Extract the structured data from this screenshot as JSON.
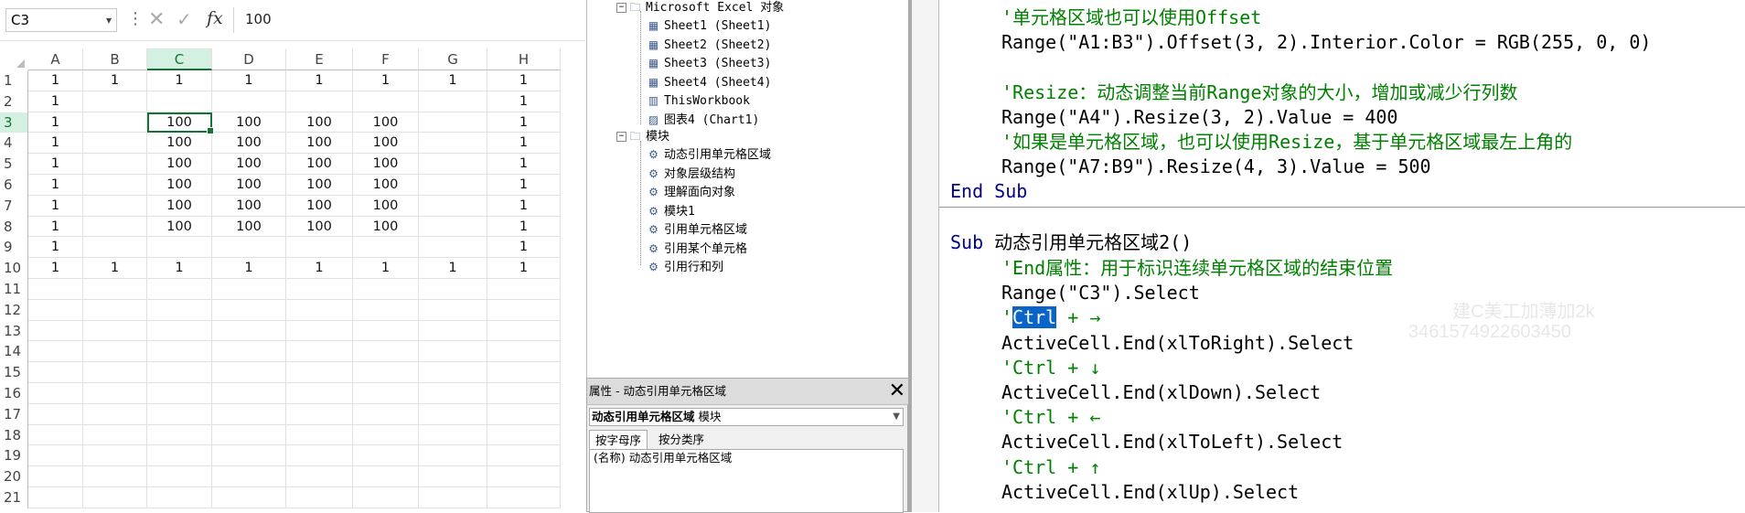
{
  "excel": {
    "name_box": "C3",
    "formula_value": "100",
    "fx_label": "fx",
    "columns": [
      "A",
      "B",
      "C",
      "D",
      "E",
      "F",
      "G",
      "H"
    ],
    "selected_column": "C",
    "selected_row": "3",
    "row_labels": [
      "1",
      "2",
      "3",
      "4",
      "5",
      "6",
      "7",
      "8",
      "9",
      "10",
      "11",
      "12",
      "13",
      "14",
      "15",
      "16",
      "17",
      "18",
      "19",
      "20",
      "21"
    ],
    "rows": [
      [
        "1",
        "1",
        "1",
        "1",
        "1",
        "1",
        "1",
        "1"
      ],
      [
        "1",
        "",
        "",
        "",
        "",
        "",
        "",
        "1"
      ],
      [
        "1",
        "",
        "100",
        "100",
        "100",
        "100",
        "",
        "1"
      ],
      [
        "1",
        "",
        "100",
        "100",
        "100",
        "100",
        "",
        "1"
      ],
      [
        "1",
        "",
        "100",
        "100",
        "100",
        "100",
        "",
        "1"
      ],
      [
        "1",
        "",
        "100",
        "100",
        "100",
        "100",
        "",
        "1"
      ],
      [
        "1",
        "",
        "100",
        "100",
        "100",
        "100",
        "",
        "1"
      ],
      [
        "1",
        "",
        "100",
        "100",
        "100",
        "100",
        "",
        "1"
      ],
      [
        "1",
        "",
        "",
        "",
        "",
        "",
        "",
        "1"
      ],
      [
        "1",
        "1",
        "1",
        "1",
        "1",
        "1",
        "1",
        "1"
      ],
      [
        "",
        "",
        "",
        "",
        "",
        "",
        "",
        ""
      ],
      [
        "",
        "",
        "",
        "",
        "",
        "",
        "",
        ""
      ],
      [
        "",
        "",
        "",
        "",
        "",
        "",
        "",
        ""
      ],
      [
        "",
        "",
        "",
        "",
        "",
        "",
        "",
        ""
      ],
      [
        "",
        "",
        "",
        "",
        "",
        "",
        "",
        ""
      ],
      [
        "",
        "",
        "",
        "",
        "",
        "",
        "",
        ""
      ],
      [
        "",
        "",
        "",
        "",
        "",
        "",
        "",
        ""
      ],
      [
        "",
        "",
        "",
        "",
        "",
        "",
        "",
        ""
      ],
      [
        "",
        "",
        "",
        "",
        "",
        "",
        "",
        ""
      ],
      [
        "",
        "",
        "",
        "",
        "",
        "",
        "",
        ""
      ],
      [
        "",
        "",
        "",
        "",
        "",
        "",
        "",
        ""
      ]
    ],
    "accent_color": "#137333"
  },
  "project": {
    "excel_objects_label": "Microsoft Excel 对象",
    "objects": [
      {
        "label": "Sheet1 (Sheet1)",
        "icon": "sheet-icon"
      },
      {
        "label": "Sheet2 (Sheet2)",
        "icon": "sheet-icon"
      },
      {
        "label": "Sheet3 (Sheet3)",
        "icon": "sheet-icon"
      },
      {
        "label": "Sheet4 (Sheet4)",
        "icon": "sheet-icon"
      },
      {
        "label": "ThisWorkbook",
        "icon": "workbook-icon"
      },
      {
        "label": "图表4 (Chart1)",
        "icon": "chart-icon"
      }
    ],
    "modules_label": "模块",
    "modules": [
      "动态引用单元格区域",
      "对象层级结构",
      "理解面向对象",
      "模块1",
      "引用单元格区域",
      "引用某个单元格",
      "引用行和列"
    ]
  },
  "properties": {
    "title": "属性 - 动态引用单元格区域",
    "close_glyph": "✕",
    "object_name": "动态引用单元格区域",
    "object_type": "模块",
    "tab_alpha": "按字母序",
    "tab_category": "按分类序",
    "row_key": "(名称)",
    "row_value": "动态引用单元格区域"
  },
  "code": {
    "lines_top": [
      {
        "type": "comment",
        "indent": 2,
        "text": "'单元格区域也可以使用Offset"
      },
      {
        "type": "code",
        "indent": 2,
        "text": "Range(\"A1:B3\").Offset(3, 2).Interior.Color = RGB(255, 0, 0)"
      },
      {
        "type": "blank",
        "indent": 0,
        "text": ""
      },
      {
        "type": "comment",
        "indent": 2,
        "text": "'Resize：动态调整当前Range对象的大小，增加或减少行列数"
      },
      {
        "type": "code",
        "indent": 2,
        "text": "Range(\"A4\").Resize(3, 2).Value = 400"
      },
      {
        "type": "comment",
        "indent": 2,
        "text": "'如果是单元格区域，也可以使用Resize，基于单元格区域最左上角的"
      },
      {
        "type": "code",
        "indent": 2,
        "text": "Range(\"A7:B9\").Resize(4, 3).Value = 500"
      },
      {
        "type": "keyword",
        "indent": 0,
        "text": "End Sub"
      }
    ],
    "sub_keyword": "Sub",
    "sub_name": "动态引用单元格区域2()",
    "lines_bottom": [
      {
        "type": "comment",
        "indent": 2,
        "text": "'End属性：用于标识连续单元格区域的结束位置"
      },
      {
        "type": "code",
        "indent": 2,
        "text": "Range(\"C3\").Select"
      },
      {
        "type": "comment-hl",
        "indent": 2,
        "text": "'",
        "hl": "Ctrl",
        "rest": " + →"
      },
      {
        "type": "code",
        "indent": 2,
        "text": "ActiveCell.End(xlToRight).Select"
      },
      {
        "type": "comment",
        "indent": 2,
        "text": "'Ctrl + ↓"
      },
      {
        "type": "code",
        "indent": 2,
        "text": "ActiveCell.End(xlDown).Select"
      },
      {
        "type": "comment",
        "indent": 2,
        "text": "'Ctrl + ←"
      },
      {
        "type": "code",
        "indent": 2,
        "text": "ActiveCell.End(xlToLeft).Select"
      },
      {
        "type": "comment",
        "indent": 2,
        "text": "'Ctrl + ↑"
      },
      {
        "type": "code",
        "indent": 2,
        "text": "ActiveCell.End(xlUp).Select"
      }
    ],
    "watermark_1": "建C美工加薄加2k",
    "watermark_2": "3461574922603450"
  }
}
